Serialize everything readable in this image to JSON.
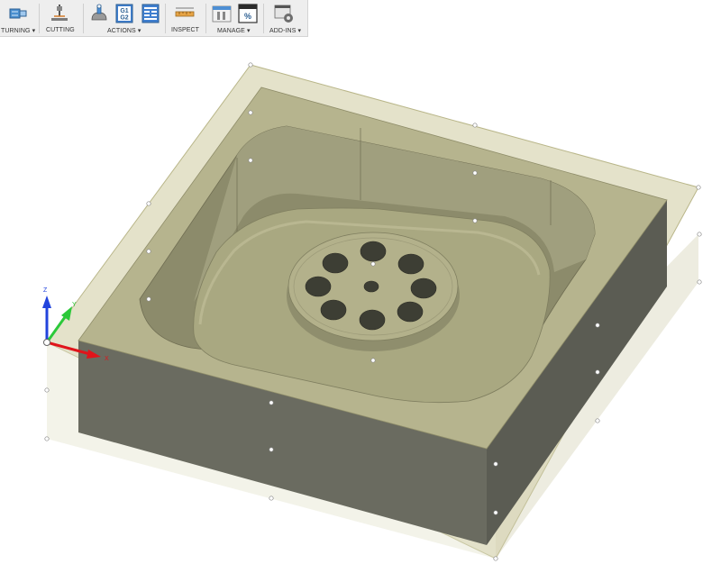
{
  "toolbar": {
    "groups": [
      {
        "label": "TURNING ▾",
        "icon": "turning-icon"
      },
      {
        "label": "CUTTING",
        "icon": "cutting-icon"
      },
      {
        "label": "ACTIONS ▾",
        "icons": [
          "simulate-icon",
          "post-process-icon",
          "setup-sheet-icon"
        ],
        "g1": "G1",
        "g2": "G2"
      },
      {
        "label": "INSPECT",
        "icon": "measure-icon"
      },
      {
        "label": "MANAGE ▾",
        "icons": [
          "tool-library-icon",
          "template-library-icon"
        ],
        "percent": "%"
      },
      {
        "label": "ADD-INS ▾",
        "icon": "add-ins-icon"
      }
    ]
  },
  "viewport": {
    "axes": {
      "z": "Z",
      "y": "Y",
      "x": "X"
    },
    "colors": {
      "stock_top": "#c9c69d",
      "part_top": "#b6b48e",
      "outer_wall_front": "#6a6b60",
      "outer_wall_right": "#5b5c53",
      "pocket_floor": "#a9a881",
      "axis_x": "#e0141b",
      "axis_y": "#2cc93a",
      "axis_z": "#2244dd"
    }
  }
}
